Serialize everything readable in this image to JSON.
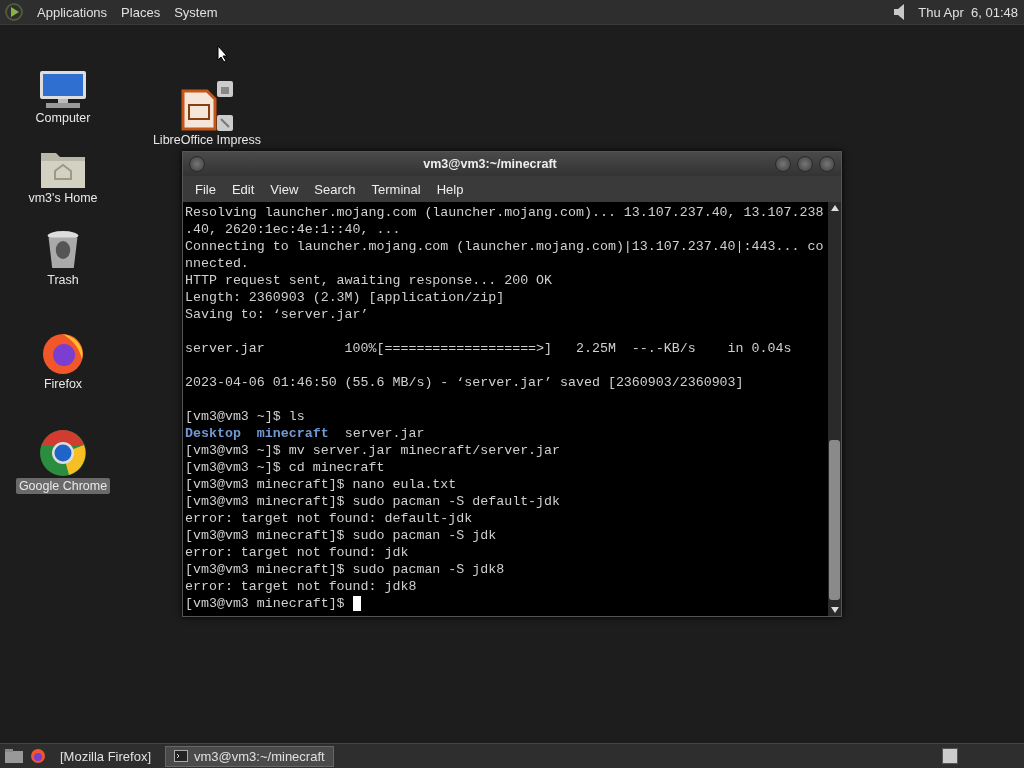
{
  "top_panel": {
    "menus": [
      "Applications",
      "Places",
      "System"
    ],
    "clock": "Thu Apr  6, 01:48"
  },
  "desktop_icons": [
    {
      "kind": "computer",
      "label": "Computer",
      "selected": false
    },
    {
      "kind": "home",
      "label": "vm3's Home",
      "selected": false
    },
    {
      "kind": "trash",
      "label": "Trash",
      "selected": false
    },
    {
      "kind": "firefox",
      "label": "Firefox",
      "selected": false
    },
    {
      "kind": "chrome",
      "label": "Google Chrome",
      "selected": true
    },
    {
      "kind": "impress",
      "label": "LibreOffice Impress",
      "selected": false
    }
  ],
  "terminal": {
    "title": "vm3@vm3:~/minecraft",
    "menus": [
      "File",
      "Edit",
      "View",
      "Search",
      "Terminal",
      "Help"
    ],
    "lines": [
      [
        {
          "kind": "text",
          "text": "Resolving launcher.mojang.com (launcher.mojang.com)... 13.107.237.40, 13.107.238"
        }
      ],
      [
        {
          "kind": "text",
          "text": ".40, 2620:1ec:4e:1::40, ..."
        }
      ],
      [
        {
          "kind": "text",
          "text": "Connecting to launcher.mojang.com (launcher.mojang.com)|13.107.237.40|:443... co"
        }
      ],
      [
        {
          "kind": "text",
          "text": "nnected."
        }
      ],
      [
        {
          "kind": "text",
          "text": "HTTP request sent, awaiting response... 200 OK"
        }
      ],
      [
        {
          "kind": "text",
          "text": "Length: 2360903 (2.3M) [application/zip]"
        }
      ],
      [
        {
          "kind": "text",
          "text": "Saving to: ‘server.jar’"
        }
      ],
      [
        {
          "kind": "blank"
        }
      ],
      [
        {
          "kind": "text",
          "text": "server.jar          100%[===================>]   2.25M  --.-KB/s    in 0.04s"
        }
      ],
      [
        {
          "kind": "blank"
        }
      ],
      [
        {
          "kind": "text",
          "text": "2023-04-06 01:46:50 (55.6 MB/s) - ‘server.jar’ saved [2360903/2360903]"
        }
      ],
      [
        {
          "kind": "blank"
        }
      ],
      [
        {
          "kind": "text",
          "text": "[vm3@vm3 ~]$ ls"
        }
      ],
      [
        {
          "kind": "dir",
          "text": "Desktop"
        },
        {
          "kind": "dir",
          "text": "minecraft"
        },
        {
          "kind": "text",
          "text": "server.jar"
        }
      ],
      [
        {
          "kind": "text",
          "text": "[vm3@vm3 ~]$ mv server.jar minecraft/server.jar"
        }
      ],
      [
        {
          "kind": "text",
          "text": "[vm3@vm3 ~]$ cd minecraft"
        }
      ],
      [
        {
          "kind": "text",
          "text": "[vm3@vm3 minecraft]$ nano eula.txt"
        }
      ],
      [
        {
          "kind": "text",
          "text": "[vm3@vm3 minecraft]$ sudo pacman -S default-jdk"
        }
      ],
      [
        {
          "kind": "text",
          "text": "error: target not found: default-jdk"
        }
      ],
      [
        {
          "kind": "text",
          "text": "[vm3@vm3 minecraft]$ sudo pacman -S jdk"
        }
      ],
      [
        {
          "kind": "text",
          "text": "error: target not found: jdk"
        }
      ],
      [
        {
          "kind": "text",
          "text": "[vm3@vm3 minecraft]$ sudo pacman -S jdk8"
        }
      ],
      [
        {
          "kind": "text",
          "text": "error: target not found: jdk8"
        }
      ],
      [
        {
          "kind": "prompt",
          "text": "[vm3@vm3 minecraft]$"
        }
      ]
    ]
  },
  "taskbar": {
    "items": [
      {
        "kind": "firefox",
        "label": "[Mozilla Firefox]",
        "selected": false
      },
      {
        "kind": "terminal",
        "label": "vm3@vm3:~/minecraft",
        "selected": true
      }
    ]
  }
}
